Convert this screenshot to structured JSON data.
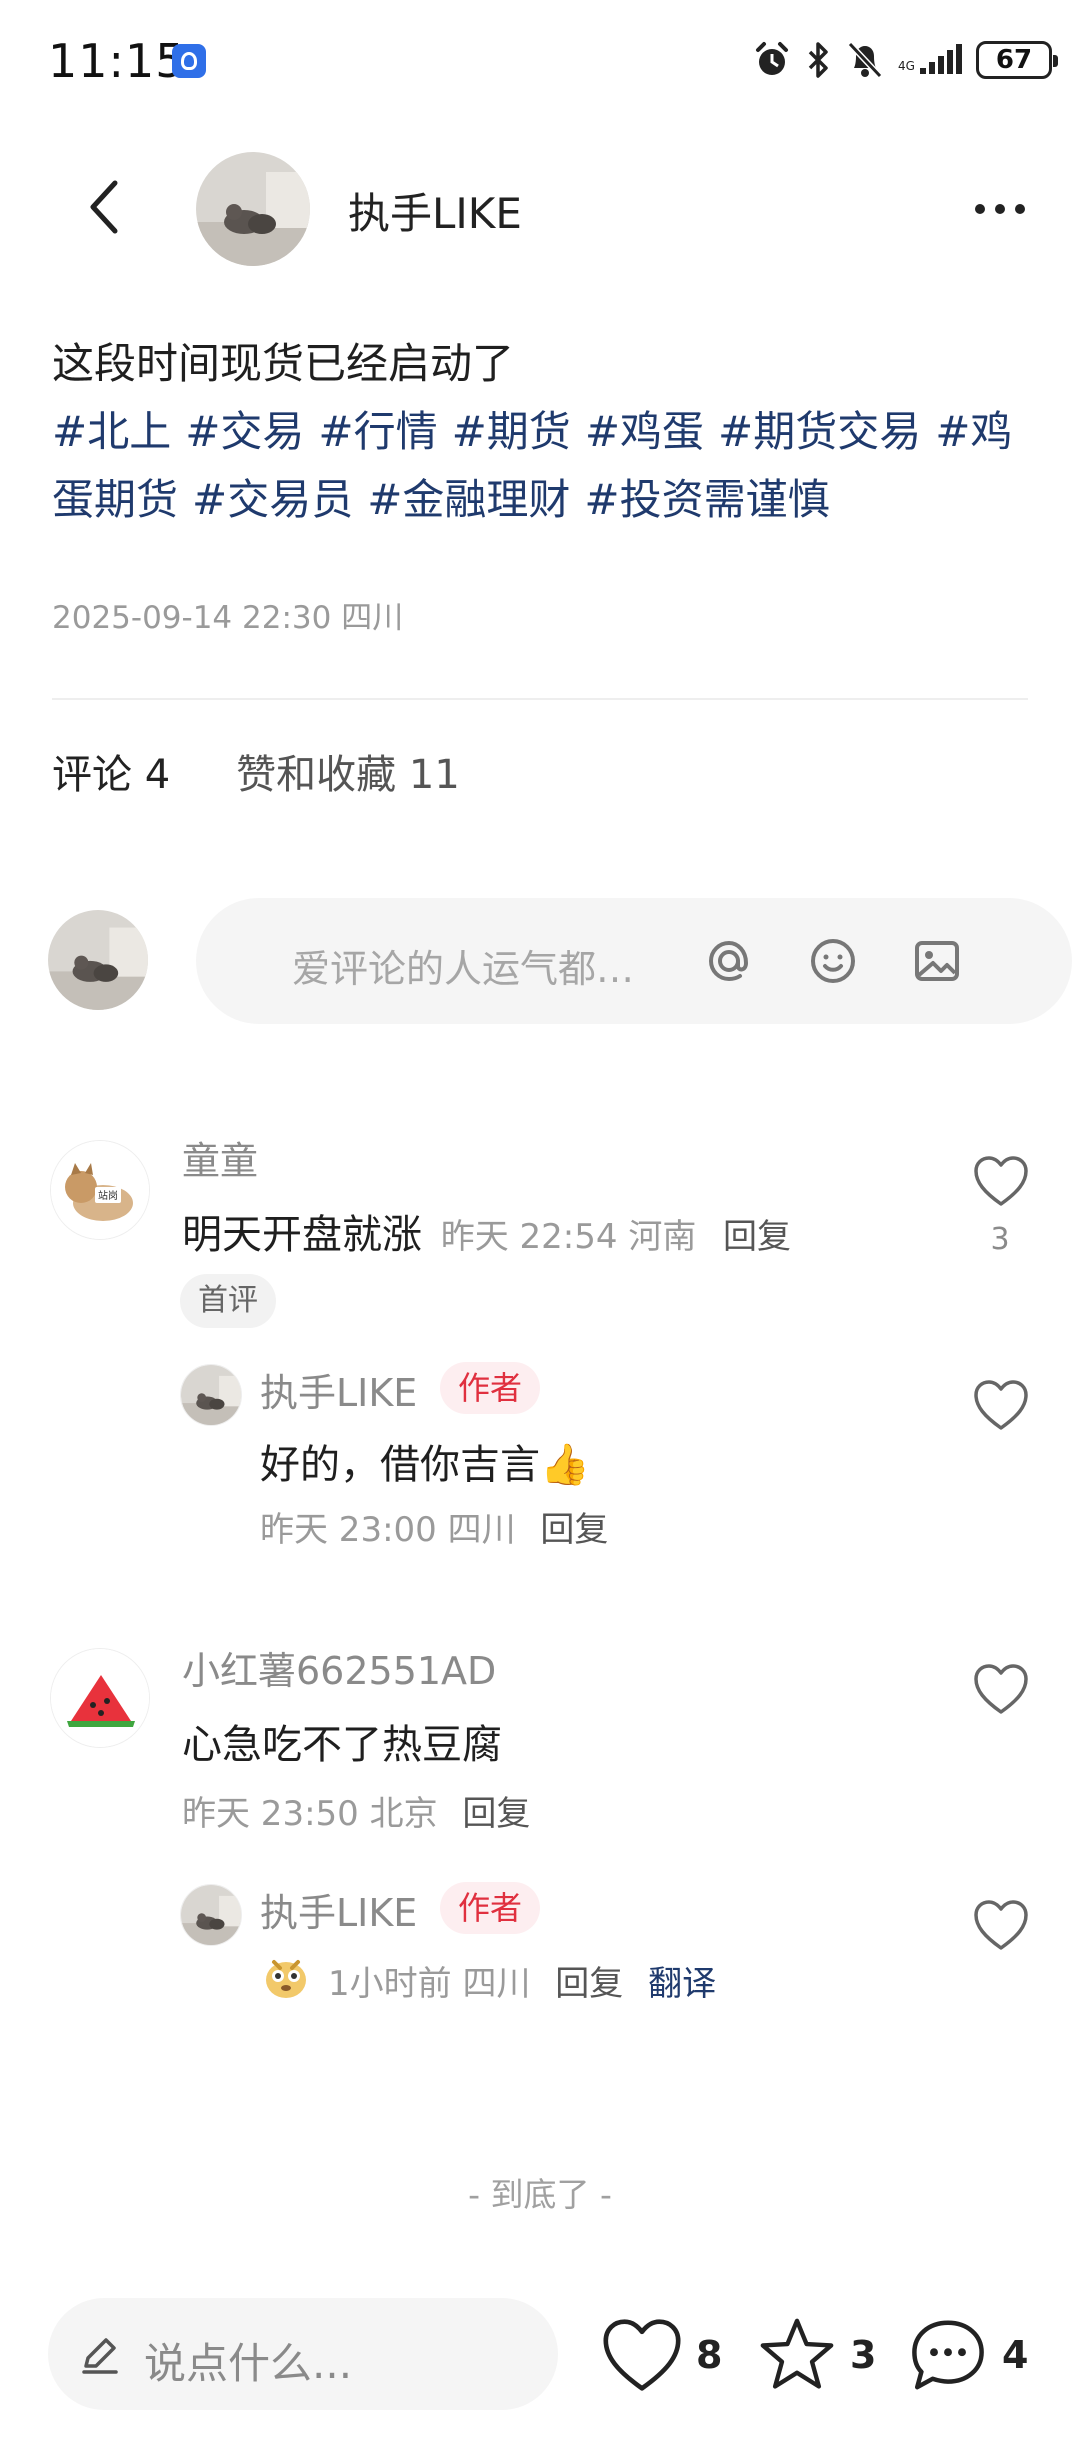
{
  "status_bar": {
    "time": "11:15",
    "battery": "67",
    "icons": [
      "alarm-icon",
      "bluetooth-icon",
      "mute-bell-icon",
      "signal-icon",
      "battery-icon"
    ]
  },
  "header": {
    "author_name": "执手LIKE"
  },
  "post": {
    "text": "这段时间现货已经启动了",
    "tags": [
      "#北上",
      "#交易",
      "#行情",
      "#期货",
      "#鸡蛋",
      "#期货交易",
      "#鸡蛋期货",
      "#交易员",
      "#金融理财",
      "#投资需谨慎"
    ],
    "meta": "2025-09-14 22:30 四川"
  },
  "tabs": {
    "comments": "评论 4",
    "likes_collects": "赞和收藏 11"
  },
  "composer": {
    "placeholder": "爱评论的人运气都…"
  },
  "comments": [
    {
      "name": "童童",
      "text": "明天开盘就涨",
      "meta": "昨天 22:54 河南",
      "reply": "回复",
      "badge": "首评",
      "likes": "3",
      "avatar_text": "站岗"
    },
    {
      "name": "执手LIKE",
      "author_badge": "作者",
      "text": "好的，借你吉言👍",
      "meta": "昨天 23:00 四川",
      "reply": "回复"
    },
    {
      "name": "小红薯662551AD",
      "text": "心急吃不了热豆腐",
      "meta": "昨天 23:50 北京",
      "reply": "回复"
    },
    {
      "name": "执手LIKE",
      "author_badge": "作者",
      "meta": "1小时前 四川",
      "reply": "回复",
      "translate": "翻译"
    }
  ],
  "end_text": "- 到底了 -",
  "bottom_bar": {
    "input_label": "说点什么...",
    "like_count": "8",
    "collect_count": "3",
    "comment_count": "4"
  },
  "colors": {
    "tag": "#1f3a6d",
    "author_badge_bg": "#fdeef0",
    "author_badge_text": "#e0303f",
    "field_bg": "#f5f5f5"
  }
}
